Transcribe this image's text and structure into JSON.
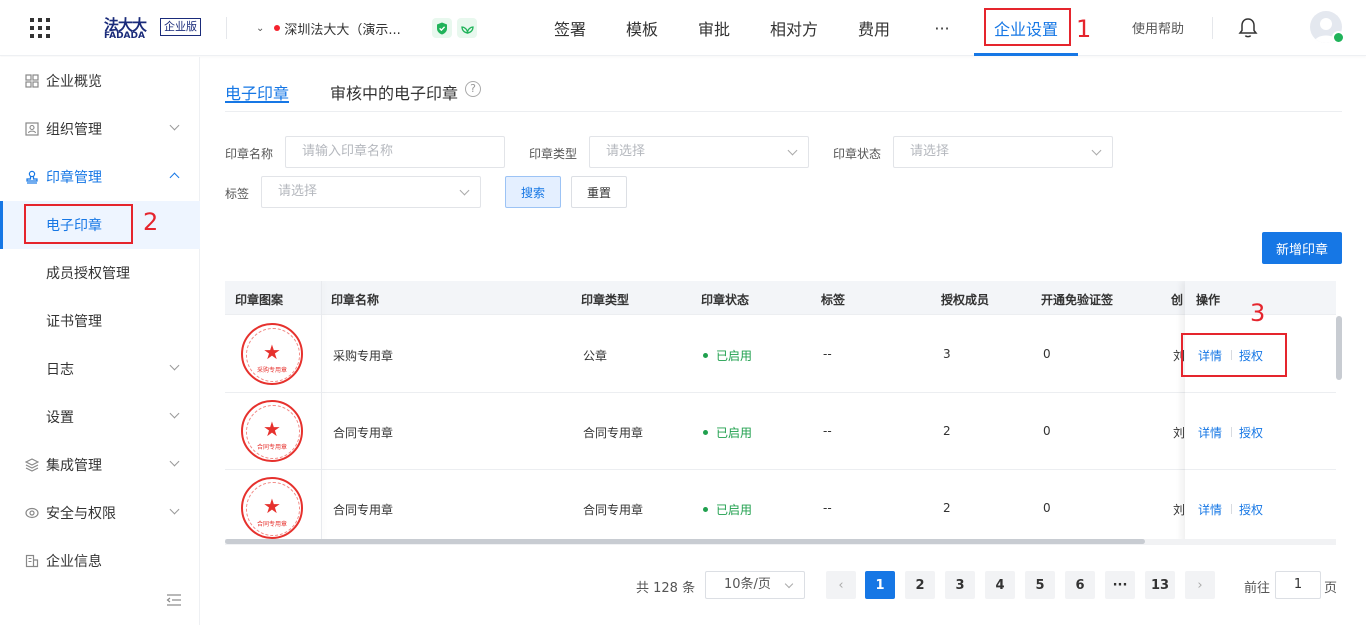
{
  "header": {
    "logo_cn": "法大大",
    "logo_en": "FADADA",
    "edition": "企业版",
    "org_name": "深圳法大大（演示...",
    "nav": [
      "签署",
      "模板",
      "审批",
      "相对方",
      "费用",
      "···",
      "企业设置"
    ],
    "active_nav": "企业设置",
    "help": "使用帮助",
    "accent_color": "#1677e5",
    "icons": [
      "grid-menu-icon",
      "chevron-down-icon",
      "shield-check-icon",
      "leaf-icon",
      "bell-icon",
      "avatar-icon"
    ]
  },
  "annotations": {
    "n1": "1",
    "n2": "2",
    "n3": "3",
    "color": "#e5252d"
  },
  "sidebar": {
    "items": [
      {
        "label": "企业概览",
        "icon": "overview-icon"
      },
      {
        "label": "组织管理",
        "icon": "org-icon"
      },
      {
        "label": "印章管理",
        "icon": "seal-icon"
      },
      {
        "label": "电子印章"
      },
      {
        "label": "成员授权管理"
      },
      {
        "label": "证书管理"
      },
      {
        "label": "日志"
      },
      {
        "label": "设置"
      },
      {
        "label": "集成管理",
        "icon": "layers-icon"
      },
      {
        "label": "安全与权限",
        "icon": "lock-icon"
      },
      {
        "label": "企业信息",
        "icon": "building-icon"
      }
    ]
  },
  "tabs": [
    {
      "label": "电子印章"
    },
    {
      "label": "审核中的电子印章"
    }
  ],
  "filters": {
    "name_label": "印章名称",
    "name_placeholder": "请输入印章名称",
    "type_label": "印章类型",
    "type_placeholder": "请选择",
    "status_label": "印章状态",
    "status_placeholder": "请选择",
    "tag_label": "标签",
    "tag_placeholder": "请选择",
    "search": "搜索",
    "reset": "重置"
  },
  "new_seal": "新增印章",
  "table": {
    "columns": [
      "印章图案",
      "印章名称",
      "印章类型",
      "印章状态",
      "标签",
      "授权成员",
      "开通免验证签",
      "创",
      "操作"
    ],
    "rows": [
      {
        "name": "采购专用章",
        "type": "公章",
        "status": "已启用",
        "tag": "--",
        "members": "3",
        "free": "0",
        "creator": "刘",
        "seal_text": "采购专用章"
      },
      {
        "name": "合同专用章",
        "type": "合同专用章",
        "status": "已启用",
        "tag": "--",
        "members": "2",
        "free": "0",
        "creator": "刘",
        "seal_text": "合同专用章"
      },
      {
        "name": "合同专用章",
        "type": "合同专用章",
        "status": "已启用",
        "tag": "--",
        "members": "2",
        "free": "0",
        "creator": "刘",
        "seal_text": "合同专用章"
      }
    ],
    "ops": {
      "detail": "详情",
      "auth": "授权"
    }
  },
  "pagination": {
    "total": "共 128 条",
    "page_size": "10条/页",
    "pages": [
      "1",
      "2",
      "3",
      "4",
      "5",
      "6",
      "···",
      "13"
    ],
    "current": "1",
    "goto_label": "前往",
    "goto_value": "1",
    "page_suffix": "页"
  }
}
